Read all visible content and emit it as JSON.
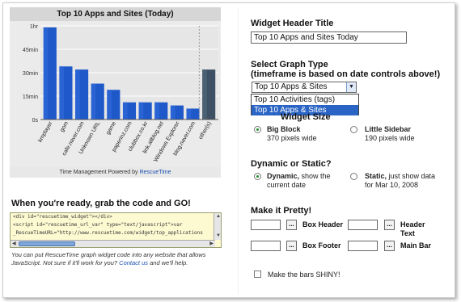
{
  "chart": {
    "title": "Top 10 Apps and Sites (Today)",
    "footer_prefix": "Time Management Powered by ",
    "footer_link": "RescueTime"
  },
  "chart_data": {
    "type": "bar",
    "title": "Top 10 Apps and Sites (Today)",
    "categories": [
      "kmplayer",
      "gom",
      "cafe.naver.com",
      "Unknown URL",
      "game",
      "paperinz.com",
      "clubbox.co.kr",
      "link.allblog.net",
      "Windows Explorer",
      "blog.naver.com",
      "other(s)"
    ],
    "values": [
      59,
      34,
      32,
      23,
      19,
      11,
      11,
      11,
      9,
      7,
      32
    ],
    "ylabel": "",
    "ylim": [
      0,
      60
    ],
    "yticks": [
      "0s",
      "15min",
      "30min",
      "45min",
      "1hr"
    ],
    "colors": {
      "bar": "#1f58c9",
      "bar_dark": "#0e3a96",
      "other": "#3d5064"
    }
  },
  "grab": {
    "title": "When you're ready, grab the code and GO!",
    "code_lines": [
      "<div id=\"rescuetime_widget\"></div>",
      "<script id=\"rescuetime_url_var\" type=\"text/javascript\">var",
      "_RescueTimeURL=\"http://www.rescuetime.com/widget/top_applications"
    ],
    "help_prefix": "You can put RescueTime graph widget code into any website that allows JavaScript. Not sure if it'll work for you? ",
    "help_link": "Contact us",
    "help_suffix": " and we'll help."
  },
  "form": {
    "header_title_label": "Widget Header Title",
    "header_title_value": "Top 10 Apps and Sites Today",
    "graph_type_label": "Select Graph Type",
    "graph_type_sub": "(timeframe is based on date controls above!)",
    "graph_type_value": "Top 10 Apps & Sites",
    "graph_type_options": [
      "Top 10 Activities (tags)",
      "Top 10 Apps & Sites"
    ],
    "widget_size_label": "Widget Size",
    "size_big_title": "Big Block",
    "size_big_desc": "370 pixels wide",
    "size_small_title": "Little Sidebar",
    "size_small_desc": "190 pixels wide",
    "dynamic_label": "Dynamic or Static?",
    "dynamic_title": "Dynamic,",
    "dynamic_desc1": " show the",
    "dynamic_desc2": "current date",
    "static_title": "Static,",
    "static_desc1": " just show data",
    "static_desc2": "for Mar 10, 2008",
    "pretty_label": "Make it Pretty!",
    "box_header": "Box Header",
    "header_text_1": "Header",
    "header_text_2": "Text",
    "box_footer": "Box Footer",
    "main_bar": "Main Bar",
    "dots": "...",
    "shiny_label": "Make the bars SHINY!"
  }
}
